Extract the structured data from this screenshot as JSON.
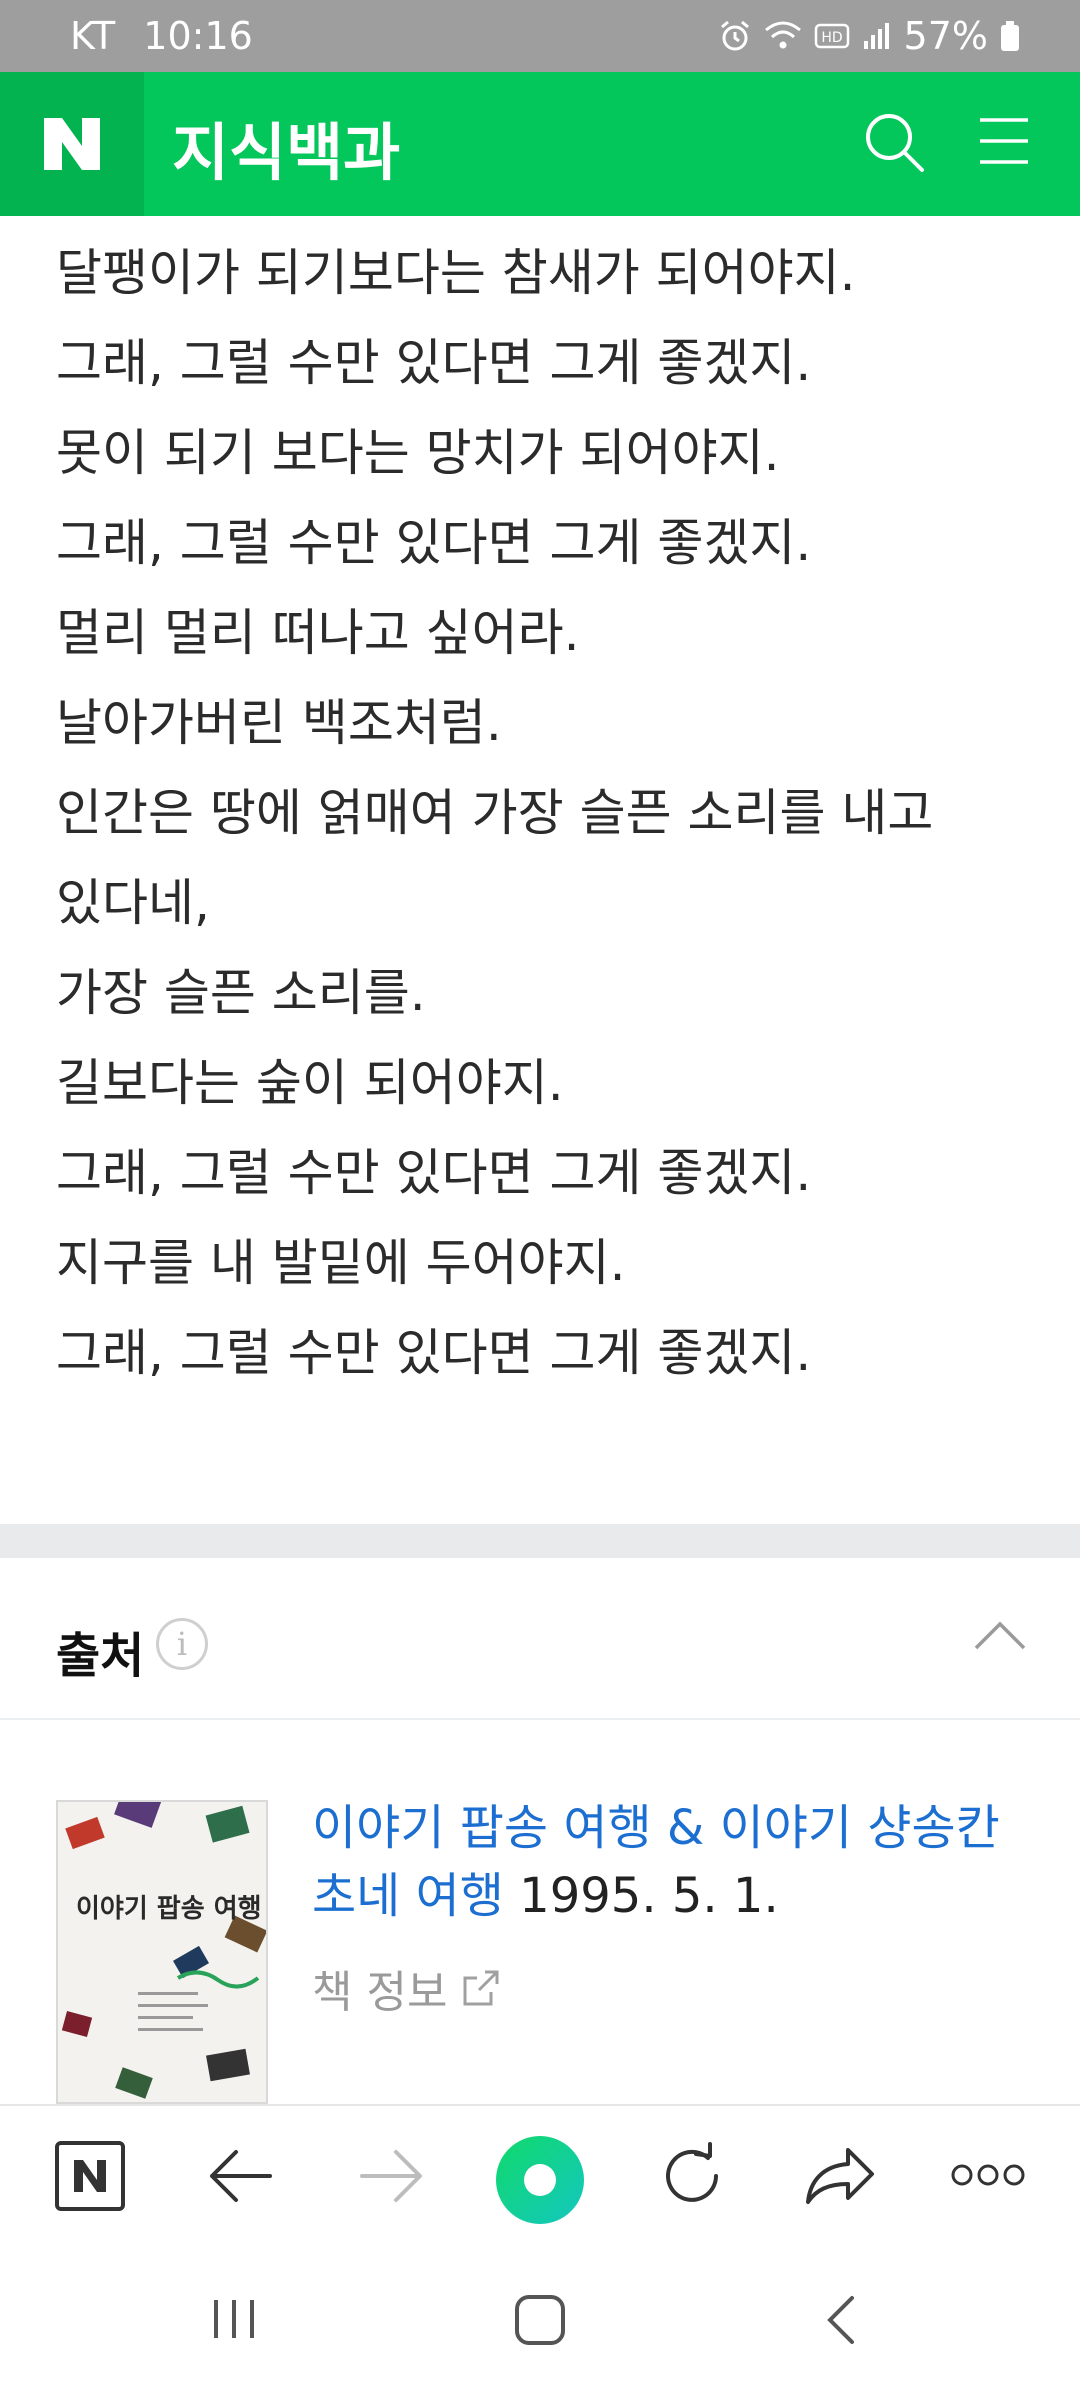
{
  "status_bar": {
    "carrier": "KT",
    "time": "10:16",
    "battery": "57%"
  },
  "header": {
    "logo": "N",
    "title": "지식백과"
  },
  "lyrics": [
    "달팽이가 되기보다는 참새가 되어야지.",
    "그래, 그럴 수만 있다면 그게 좋겠지.",
    "못이 되기 보다는 망치가 되어야지.",
    "그래, 그럴 수만 있다면 그게 좋겠지.",
    "멀리 멀리 떠나고 싶어라.",
    "날아가버린 백조처럼.",
    "인간은 땅에 얽매여 가장 슬픈 소리를 내고",
    "있다네,",
    "가장 슬픈 소리를.",
    "길보다는 숲이 되어야지.",
    "그래, 그럴 수만 있다면 그게 좋겠지.",
    "지구를 내 발밑에 두어야지.",
    "그래, 그럴 수만 있다면 그게 좋겠지."
  ],
  "source": {
    "label": "출처",
    "info_icon": "i",
    "book": {
      "title": "이야기 팝송 여행 & 이야기 샹송칸초네 여행",
      "date": "1995. 5. 1.",
      "info_link": "책 정보",
      "cover_text": "이야기 팝송 여행"
    }
  },
  "browser_bar": {
    "home_label": "N"
  },
  "colors": {
    "brand_green": "#03c75a",
    "link_blue": "#1c6fd1"
  }
}
